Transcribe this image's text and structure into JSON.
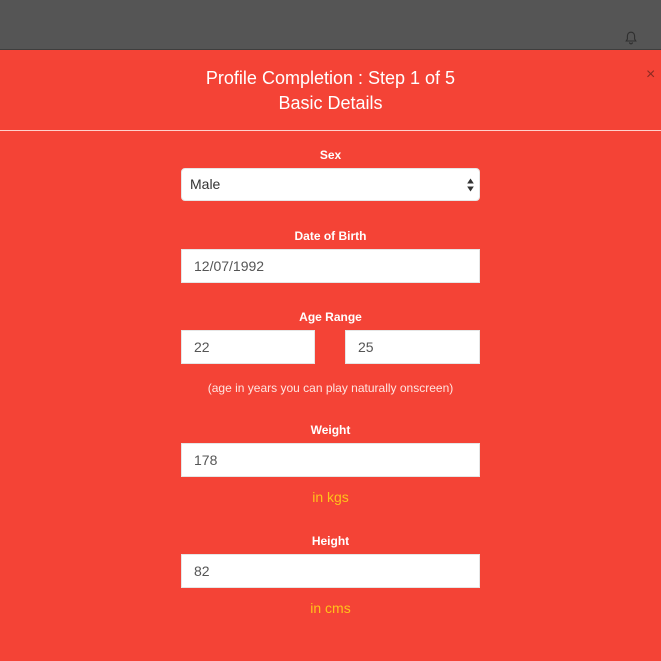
{
  "header": {
    "notification_icon": "bell-icon"
  },
  "modal": {
    "close_label": "×",
    "title_line1": "Profile Completion : Step 1 of 5",
    "title_line2": "Basic Details"
  },
  "form": {
    "sex": {
      "label": "Sex",
      "selected": "Male"
    },
    "dob": {
      "label": "Date of Birth",
      "value": "12/07/1992"
    },
    "age_range": {
      "label": "Age Range",
      "min": "22",
      "max": "25",
      "hint": "(age in years you can play naturally onscreen)"
    },
    "weight": {
      "label": "Weight",
      "value": "178",
      "unit": "in kgs"
    },
    "height": {
      "label": "Height",
      "value": "82",
      "unit": "in cms"
    }
  },
  "colors": {
    "modal_bg": "#f44336",
    "topbar_bg": "#555555",
    "unit_text": "#ffc21a"
  }
}
